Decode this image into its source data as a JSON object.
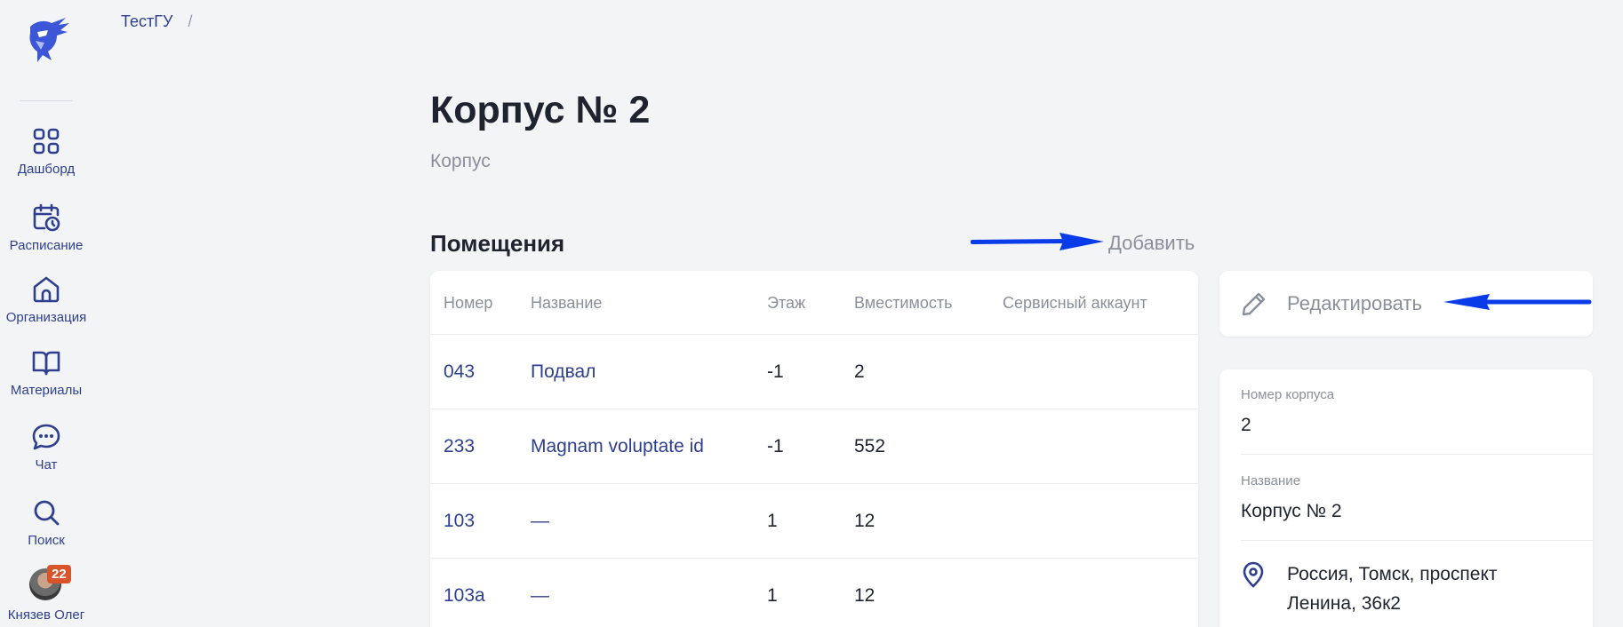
{
  "sidebar": {
    "items": [
      {
        "label": "Дашборд",
        "icon": "dashboard-icon"
      },
      {
        "label": "Расписание",
        "icon": "calendar-clock-icon"
      },
      {
        "label": "Организация",
        "icon": "home-icon"
      },
      {
        "label": "Материалы",
        "icon": "book-icon"
      },
      {
        "label": "Чат",
        "icon": "chat-icon"
      },
      {
        "label": "Поиск",
        "icon": "search-icon"
      }
    ],
    "profile": {
      "name": "Князев Олег",
      "badge": "22"
    }
  },
  "breadcrumb": {
    "root": "ТестГУ",
    "separator": "/"
  },
  "page": {
    "title": "Корпус № 2",
    "subtitle": "Корпус"
  },
  "rooms": {
    "title": "Помещения",
    "add_label": "Добавить",
    "columns": [
      "Номер",
      "Название",
      "Этаж",
      "Вместимость",
      "Сервисный аккаунт"
    ],
    "rows": [
      {
        "number": "043",
        "name": "Подвал",
        "floor": "-1",
        "capacity": "2",
        "service": ""
      },
      {
        "number": "233",
        "name": "Magnam voluptate id",
        "floor": "-1",
        "capacity": "552",
        "service": ""
      },
      {
        "number": "103",
        "name": "—",
        "floor": "1",
        "capacity": "12",
        "service": ""
      },
      {
        "number": "103а",
        "name": "—",
        "floor": "1",
        "capacity": "12",
        "service": ""
      }
    ]
  },
  "edit": {
    "label": "Редактировать"
  },
  "info": {
    "number_label": "Номер корпуса",
    "number_value": "2",
    "name_label": "Название",
    "name_value": "Корпус № 2",
    "address": "Россия, Томск, проспект Ленина, 36к2"
  },
  "colors": {
    "accent": "#2e3f8f",
    "arrow": "#0a3be8",
    "badge": "#d9532b",
    "background": "#f3f4f6"
  }
}
